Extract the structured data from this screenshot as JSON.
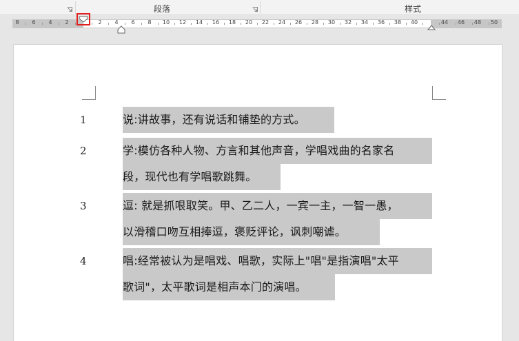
{
  "ribbon": {
    "groups": [
      {
        "label": "段落"
      },
      {
        "label": "样式"
      }
    ]
  },
  "ruler": {
    "left_numbers": [
      "8",
      "6",
      "4",
      "2"
    ],
    "right_numbers": [
      "2",
      "4",
      "6",
      "8",
      "10",
      "12",
      "14",
      "16",
      "18",
      "20",
      "22",
      "24",
      "26",
      "28",
      "30",
      "32",
      "34",
      "36",
      "38",
      "40"
    ],
    "far_right_numbers": [
      "44",
      "46",
      "48",
      "50"
    ]
  },
  "document": {
    "paragraphs": [
      {
        "number": "1",
        "lines": [
          "说:讲故事，还有说话和铺垫的方式。"
        ]
      },
      {
        "number": "2",
        "lines": [
          "学:模仿各种人物、方言和其他声音，学唱戏曲的名家名",
          "段，现代也有学唱歌跳舞。"
        ]
      },
      {
        "number": "3",
        "lines": [
          "逗: 就是抓哏取笑。甲、乙二人，一宾一主，一智一愚，",
          "以滑稽口吻互相捧逗，褒贬评论，讽刺嘲谑。"
        ]
      },
      {
        "number": "4",
        "lines": [
          "唱:经常被认为是唱戏、唱歌，实际上\"唱\"是指演唱\"太平",
          "歌词\"，太平歌词是相声本门的演唱。"
        ]
      }
    ]
  },
  "colors": {
    "selection": "#c9c9c9",
    "highlight_box": "#e02020"
  }
}
